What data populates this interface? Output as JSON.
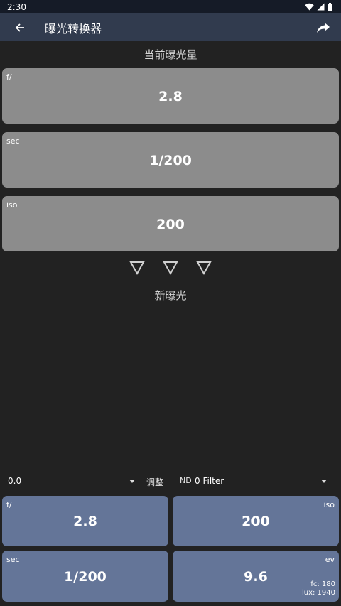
{
  "status_bar": {
    "time": "2:30"
  },
  "app_bar": {
    "title": "曝光转换器"
  },
  "current": {
    "title": "当前曝光量",
    "aperture": {
      "label": "f/",
      "value": "2.8"
    },
    "shutter": {
      "label": "sec",
      "value": "1/200"
    },
    "iso": {
      "label": "iso",
      "value": "200"
    }
  },
  "new_exposure": {
    "title": "新曝光",
    "ev_adjust": {
      "value": "0.0",
      "label": "调整"
    },
    "filter": {
      "prefix": "ND",
      "value": "0 Filter"
    },
    "aperture": {
      "label": "f/",
      "value": "2.8"
    },
    "iso": {
      "label": "iso",
      "value": "200"
    },
    "shutter": {
      "label": "sec",
      "value": "1/200"
    },
    "ev": {
      "label": "ev",
      "value": "9.6",
      "fc": "fc: 180",
      "lux": "lux: 1940"
    }
  },
  "colors": {
    "app_bar": "#313b4e",
    "background": "#222222",
    "gray_card": "#8c8c8c",
    "blue_card": "#647598"
  },
  "icons": [
    "wifi-icon",
    "signal-icon",
    "battery-icon",
    "back-arrow-icon",
    "share-icon",
    "down-triangle-icon",
    "caret-down-icon"
  ]
}
